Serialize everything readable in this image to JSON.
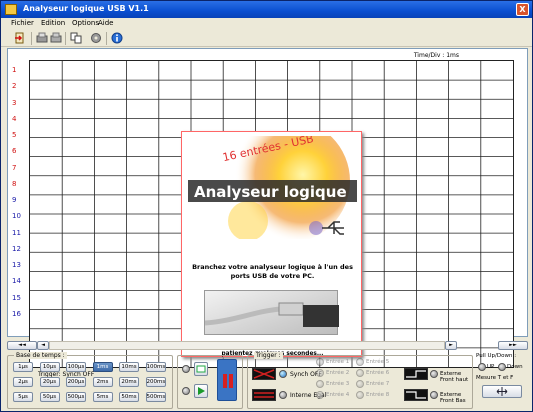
{
  "window": {
    "title": "Analyseur logique USB V1.1",
    "close_glyph": "X"
  },
  "menu": [
    "Fichier",
    "Edition",
    "Options",
    "Aide"
  ],
  "toolbar": {
    "icons": [
      "exit-icon",
      "print-icon",
      "print-preview-icon",
      "copy-icon",
      "settings-icon",
      "info-icon"
    ]
  },
  "plot": {
    "time_div": "Time/Div : 1ms",
    "rows": [
      "1",
      "2",
      "3",
      "4",
      "5",
      "6",
      "7",
      "8",
      "9",
      "10",
      "11",
      "12",
      "13",
      "14",
      "15",
      "16"
    ],
    "trigger_status": "Trigger: Synch OFF"
  },
  "splash": {
    "title": "Analyseur logique",
    "subtitle": "16 entrées - USB",
    "message1": "Branchez votre analyseur logique à l'un des ports USB de votre PC.",
    "message2": "Mettez l'analyseur logique sous tension et patientez quelques secondes..."
  },
  "scroll": {
    "left": "◄◄",
    "step_left": "◄",
    "step_right": "►",
    "right": "►►"
  },
  "timebase": {
    "label": "Base de temps :",
    "buttons": [
      "1µs",
      "10µs",
      "100µs",
      "1ms",
      "10ms",
      "100ms",
      "2µs",
      "20µs",
      "200µs",
      "2ms",
      "20ms",
      "200ms",
      "5µs",
      "50µs",
      "500µs",
      "5ms",
      "50ms",
      "500ms"
    ],
    "selected": "1ms"
  },
  "trigger": {
    "label": "Trigger :",
    "synch_off": "Synch OFF",
    "interne_egal": "Interne Egal",
    "entrees": [
      "Entrée 1",
      "Entrée 2",
      "Entrée 3",
      "Entrée 4",
      "Entrée 5",
      "Entrée 6",
      "Entrée 7",
      "Entrée 8"
    ],
    "ext_haut": "Externe Front haut",
    "ext_bas": "Externe Front Bas"
  },
  "pull": {
    "label": "Pull Up/Down :",
    "up": "UP",
    "down": "Down",
    "mesure": "Mesure T et F"
  },
  "colors": {
    "title": "#0a4fd0",
    "grid": "#222222",
    "row_red": "#d01010",
    "row_blue": "#1a1aa8",
    "pause": "#c81e1e",
    "selected": "#3d6aa8"
  }
}
